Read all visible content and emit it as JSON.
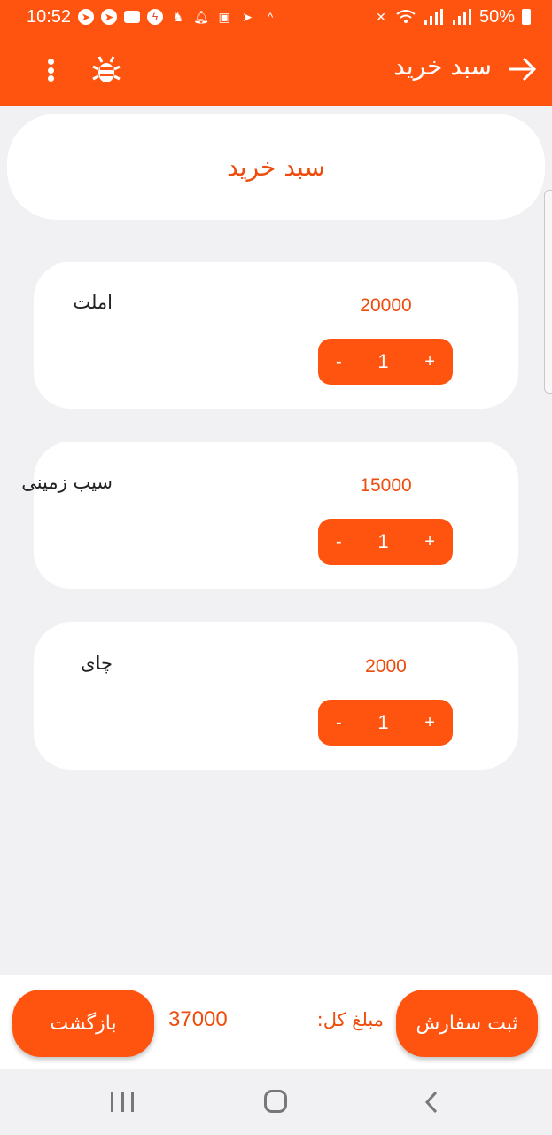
{
  "status_bar": {
    "time": "10:52",
    "battery": "50%",
    "icons": [
      "telegram-icon",
      "telegram-icon",
      "chat-bubble-icon",
      "bolt-icon",
      "person-icon",
      "bell-icon",
      "gallery-icon",
      "telegram-icon",
      "caret-up-icon",
      "mute-icon",
      "wifi-icon",
      "signal-icon",
      "signal-icon",
      "battery-icon"
    ]
  },
  "app_bar": {
    "title": "سبد خرید",
    "icons": [
      "more-vert-icon",
      "bug-icon",
      "arrow-right-icon"
    ]
  },
  "header": {
    "title": "سبد خرید"
  },
  "items": [
    {
      "name": "املت",
      "price": "20000",
      "qty": "1",
      "minus": "-",
      "plus": "+"
    },
    {
      "name": "سیب زمینی",
      "price": "15000",
      "qty": "1",
      "minus": "-",
      "plus": "+"
    },
    {
      "name": "چای",
      "price": "2000",
      "qty": "1",
      "minus": "-",
      "plus": "+"
    }
  ],
  "footer": {
    "back_label": "بازگشت",
    "total_value": "37000",
    "total_label": "مبلغ کل:",
    "submit_label": "ثبت سفارش"
  },
  "colors": {
    "accent": "#ff5310",
    "accent_text": "#ee4c0c",
    "background": "#f1f1f3"
  }
}
